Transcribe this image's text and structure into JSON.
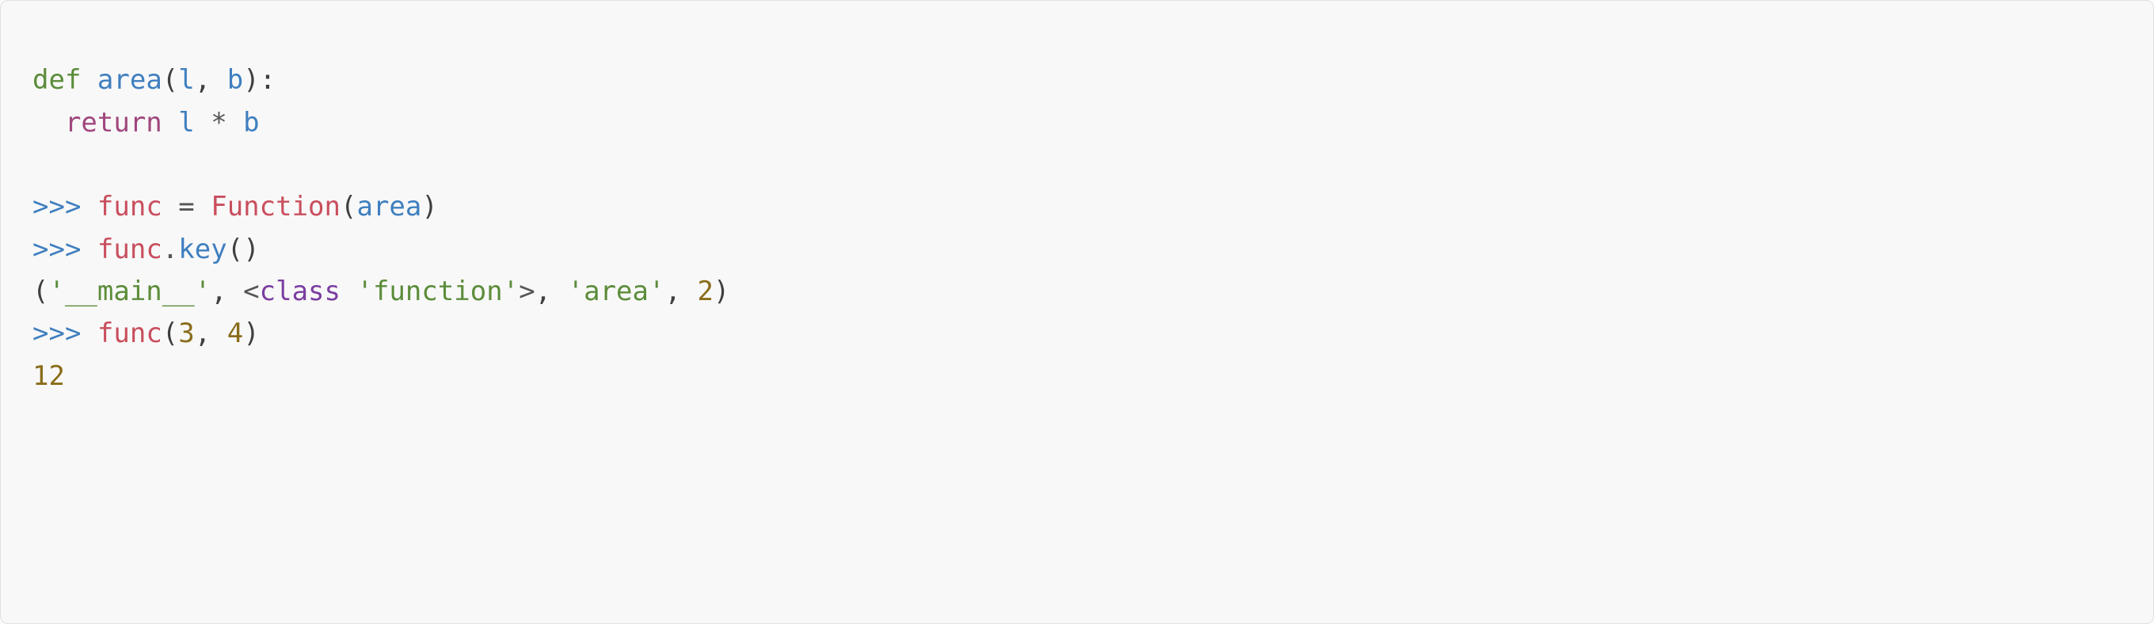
{
  "code": {
    "line1_def": "def",
    "line1_name": "area",
    "line1_paren_open": "(",
    "line1_arg1": "l",
    "line1_comma1": ",",
    "line1_space1": " ",
    "line1_arg2": "b",
    "line1_paren_close": ")",
    "line1_colon": ":",
    "line2_indent": "  ",
    "line2_return": "return",
    "line2_space": " ",
    "line2_l": "l",
    "line2_sp_star_sp": " * ",
    "line2_b": "b",
    "line4_prompt": ">>>",
    "line4_sp": " ",
    "line4_func": "func",
    "line4_sp_eq_sp": " = ",
    "line4_Function": "Function",
    "line4_po": "(",
    "line4_area": "area",
    "line4_pc": ")",
    "line5_prompt": ">>>",
    "line5_sp": " ",
    "line5_func": "func",
    "line5_dot": ".",
    "line5_key": "key",
    "line5_po": "(",
    "line5_pc": ")",
    "line6_po": "(",
    "line6_str_main": "'__main__'",
    "line6_comma1": ",",
    "line6_sp1": " ",
    "line6_lt": "<",
    "line6_class_kw": "class",
    "line6_sp2": " ",
    "line6_str_function": "'function'",
    "line6_gt": ">",
    "line6_comma2": ",",
    "line6_sp3": " ",
    "line6_str_area": "'area'",
    "line6_comma3": ",",
    "line6_sp4": " ",
    "line6_num2": "2",
    "line6_pc": ")",
    "line7_prompt": ">>>",
    "line7_sp": " ",
    "line7_func": "func",
    "line7_po": "(",
    "line7_num3": "3",
    "line7_comma": ",",
    "line7_sp2": " ",
    "line7_num4": "4",
    "line7_pc": ")",
    "line8_out": "12"
  }
}
